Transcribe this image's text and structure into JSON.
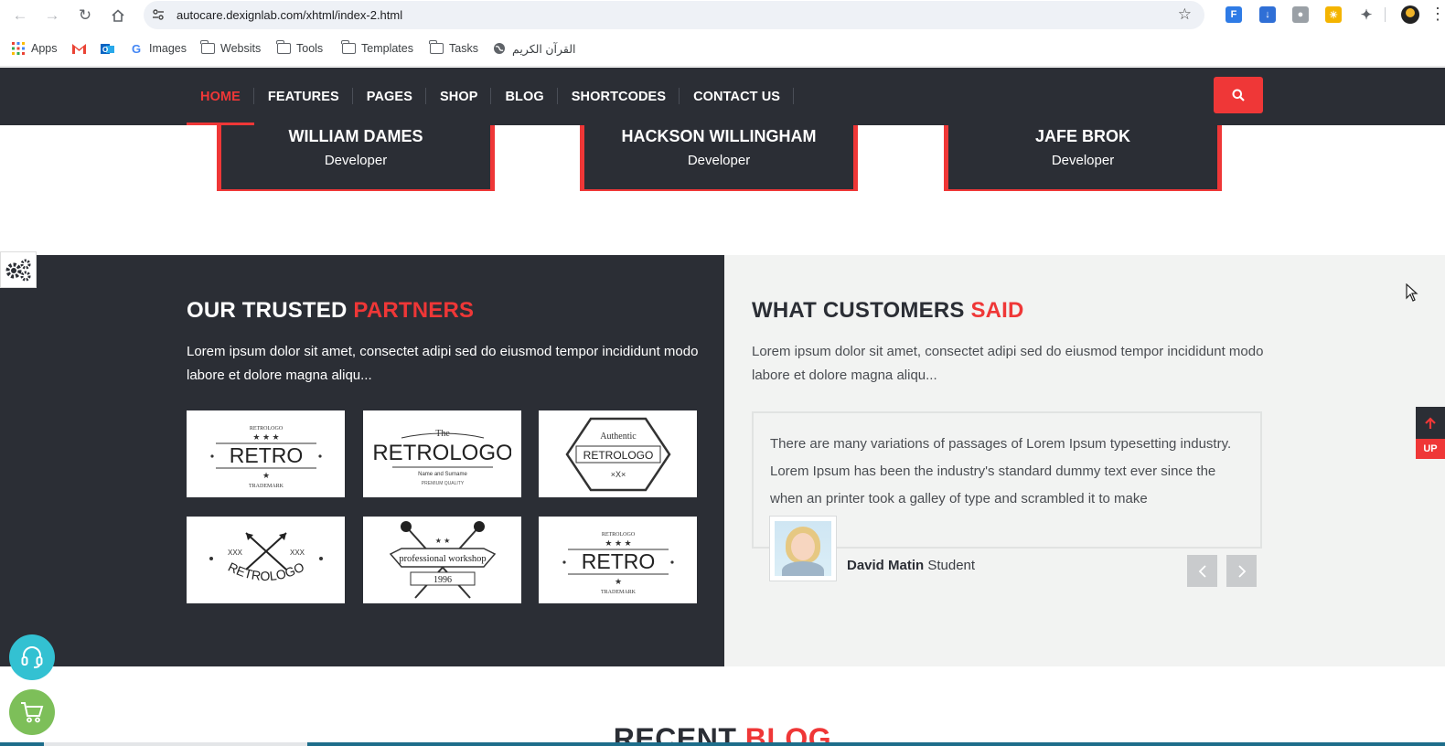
{
  "browser": {
    "url": "autocare.dexignlab.com/xhtml/index-2.html",
    "bookmarks": [
      {
        "label": "Apps",
        "icon": "apps-grid-icon"
      },
      {
        "label": "",
        "icon": "gmail-icon"
      },
      {
        "label": "",
        "icon": "outlook-icon"
      },
      {
        "label": "Images",
        "icon": "google-icon"
      },
      {
        "label": "Websits",
        "icon": "folder-icon"
      },
      {
        "label": "Tools",
        "icon": "folder-icon"
      },
      {
        "label": "Templates",
        "icon": "folder-icon"
      },
      {
        "label": "Tasks",
        "icon": "folder-icon"
      },
      {
        "label": "القرآن الكريم",
        "icon": "globe-icon"
      }
    ]
  },
  "nav": {
    "items": [
      {
        "label": "HOME",
        "active": true
      },
      {
        "label": "FEATURES",
        "active": false
      },
      {
        "label": "PAGES",
        "active": false
      },
      {
        "label": "SHOP",
        "active": false
      },
      {
        "label": "BLOG",
        "active": false
      },
      {
        "label": "SHORTCODES",
        "active": false
      },
      {
        "label": "CONTACT US",
        "active": false
      }
    ]
  },
  "team": [
    {
      "name": "WILLIAM DAMES",
      "role": "Developer"
    },
    {
      "name": "HACKSON WILLINGHAM",
      "role": "Developer"
    },
    {
      "name": "JAFE BROK",
      "role": "Developer"
    }
  ],
  "partners": {
    "title_main": "OUR TRUSTED ",
    "title_highlight": "PARTNERS",
    "description": "Lorem ipsum dolor sit amet, consectet adipi sed do eiusmod tempor incididunt modo labore et dolore magna aliqu...",
    "logos": [
      {
        "text": "RETRO",
        "top": "RETROLOGO",
        "bottom": "TRADEMARK"
      },
      {
        "text": "RETROLOGO",
        "top": "The",
        "bottom": "Name and Surname"
      },
      {
        "text": "RETROLOGO",
        "top": "Authentic",
        "bottom": "×X×"
      },
      {
        "text": "RETROLOGO",
        "top": "XXX",
        "bottom": ""
      },
      {
        "text": "professional workshop",
        "top": "",
        "bottom": "1996"
      },
      {
        "text": "RETRO",
        "top": "RETROLOGO",
        "bottom": "TRADEMARK"
      }
    ]
  },
  "testimonials": {
    "title_main": "WHAT CUSTOMERS ",
    "title_highlight": "SAID",
    "description": "Lorem ipsum dolor sit amet, consectet adipi sed do eiusmod tempor incididunt modo labore et dolore magna aliqu...",
    "quote": "There are many variations of passages of Lorem Ipsum typesetting industry. Lorem Ipsum has been the industry's standard dummy text ever since the when an printer took a galley of type and scrambled it to make",
    "author_name": "David Matin",
    "author_role": " Student"
  },
  "floating": {
    "up_label": "UP"
  },
  "recent_blog": {
    "title_main": "RECENT ",
    "title_highlight": "BLOG"
  },
  "colors": {
    "accent": "#ef3737",
    "dark": "#2b2e35",
    "light_bg": "#f2f3f2"
  }
}
